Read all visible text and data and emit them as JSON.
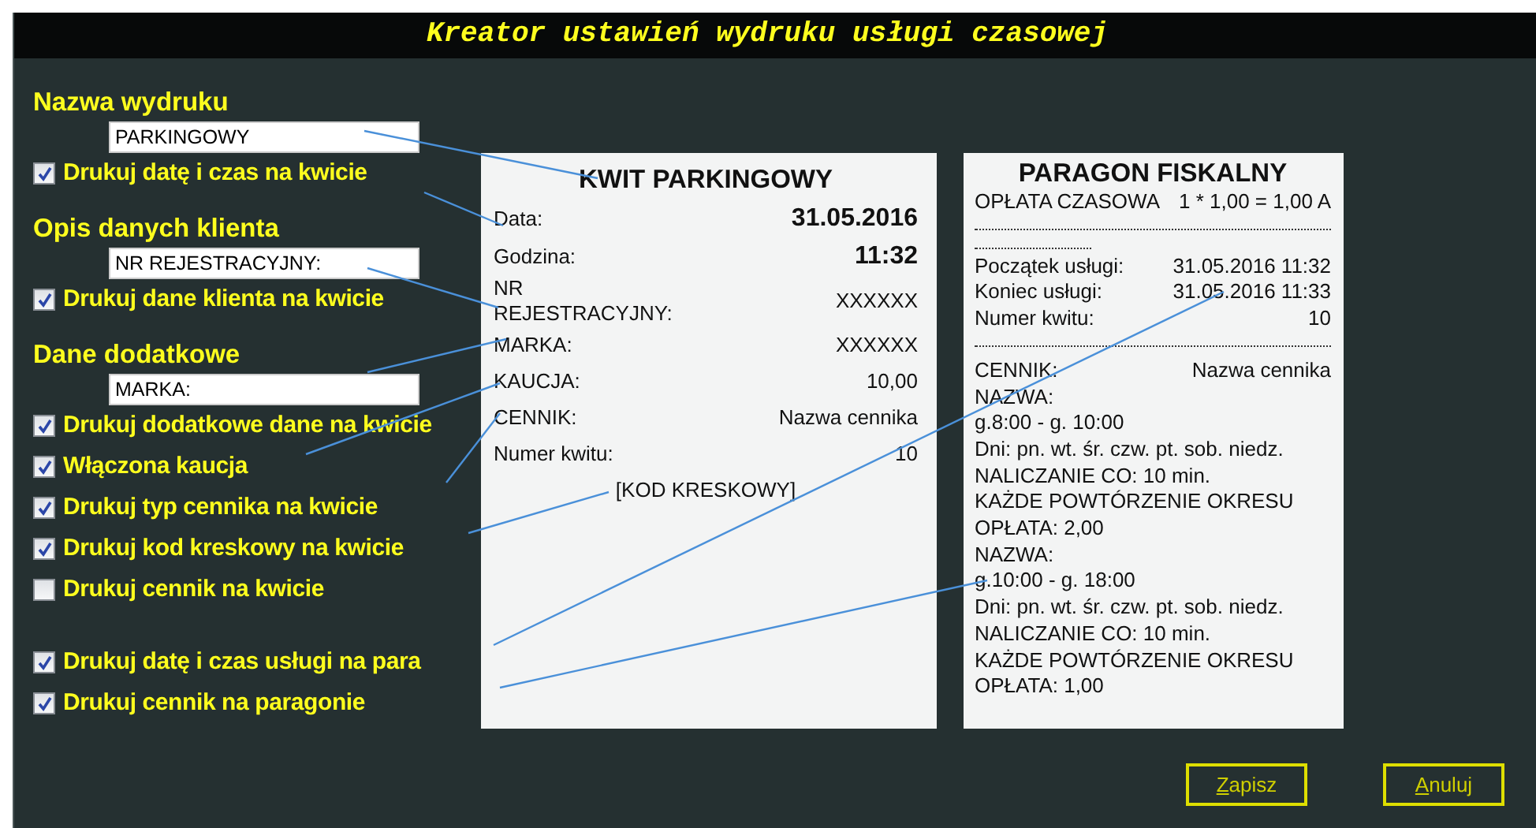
{
  "window": {
    "title": "Kreator ustawień wydruku usługi czasowej"
  },
  "ticket_options": [
    {
      "kind": "label",
      "text": "Nazwa wydruku"
    },
    {
      "kind": "field",
      "value": "PARKINGOWY"
    },
    {
      "kind": "checkbox",
      "label": "Drukuj datę i czas na kwicie",
      "checked": true
    },
    {
      "kind": "label",
      "text": "Opis danych klienta"
    },
    {
      "kind": "field",
      "value": "NR REJESTRACYJNY:"
    },
    {
      "kind": "checkbox",
      "label": "Drukuj dane klienta na kwicie",
      "checked": true
    },
    {
      "kind": "label",
      "text": "Dane dodatkowe"
    },
    {
      "kind": "field",
      "value": "MARKA:"
    },
    {
      "kind": "checkbox",
      "label": "Drukuj dodatkowe dane na kwicie",
      "checked": true
    },
    {
      "kind": "checkbox",
      "label": "Włączona kaucja",
      "checked": true
    },
    {
      "kind": "checkbox",
      "label": "Drukuj typ cennika na kwicie",
      "checked": true
    },
    {
      "kind": "checkbox",
      "label": "Drukuj kod kreskowy na kwicie",
      "checked": true
    },
    {
      "kind": "checkbox",
      "label": "Drukuj cennik na kwicie",
      "checked": false
    }
  ],
  "receipt_options": [
    {
      "kind": "checkbox",
      "label": "Drukuj datę i czas usługi na para",
      "checked": true
    },
    {
      "kind": "checkbox",
      "label": "Drukuj cennik na paragonie",
      "checked": true
    }
  ],
  "ticket": {
    "title": "KWIT PARKINGOWY",
    "rows": [
      {
        "label": "Data:",
        "value": "31.05.2016",
        "emphasis": true
      },
      {
        "label": "Godzina:",
        "value": "11:32",
        "emphasis": true
      },
      {
        "label": "NR REJESTRACYJNY:",
        "value": "XXXXXX",
        "emphasis": false
      },
      {
        "label": "MARKA:",
        "value": "XXXXXX",
        "emphasis": false
      },
      {
        "label": "KAUCJA:",
        "value": "10,00",
        "emphasis": false
      },
      {
        "label": "CENNIK:",
        "value": "Nazwa cennika",
        "emphasis": false
      },
      {
        "label": "Numer kwitu:",
        "value": "10",
        "emphasis": false
      }
    ],
    "barcode": "[KOD KRESKOWY]"
  },
  "receipt": {
    "title": "PARAGON FISKALNY",
    "lines": [
      {
        "kind": "pair",
        "label": "OPŁATA CZASOWA",
        "value": "1 * 1,00 = 1,00 A"
      },
      {
        "kind": "rule"
      },
      {
        "kind": "short-rule"
      },
      {
        "kind": "pair",
        "label": "Początek usługi:",
        "value": "31.05.2016 11:32"
      },
      {
        "kind": "pair",
        "label": "Koniec usługi:",
        "value": "31.05.2016 11:33"
      },
      {
        "kind": "pair",
        "label": "Numer kwitu:",
        "value": "10"
      },
      {
        "kind": "rule"
      },
      {
        "kind": "pair",
        "label": "CENNIK:",
        "value": "Nazwa cennika"
      },
      {
        "kind": "text",
        "text": "NAZWA:"
      },
      {
        "kind": "text",
        "text": "g.8:00 - g. 10:00"
      },
      {
        "kind": "text",
        "text": "Dni: pn. wt. śr. czw. pt. sob. niedz."
      },
      {
        "kind": "text",
        "text": "NALICZANIE CO: 10 min."
      },
      {
        "kind": "text",
        "text": "KAŻDE POWTÓRZENIE OKRESU"
      },
      {
        "kind": "text",
        "text": "OPŁATA: 2,00"
      },
      {
        "kind": "text",
        "text": "NAZWA:"
      },
      {
        "kind": "text",
        "text": "g.10:00 - g. 18:00"
      },
      {
        "kind": "text",
        "text": "Dni: pn. wt. śr. czw. pt. sob. niedz."
      },
      {
        "kind": "text",
        "text": "NALICZANIE CO: 10 min."
      },
      {
        "kind": "text",
        "text": "KAŻDE POWTÓRZENIE OKRESU"
      },
      {
        "kind": "text",
        "text": "OPŁATA: 1,00"
      }
    ]
  },
  "buttons": [
    {
      "accel": "Z",
      "rest": "apisz"
    },
    {
      "accel": "A",
      "rest": "nuluj"
    }
  ]
}
